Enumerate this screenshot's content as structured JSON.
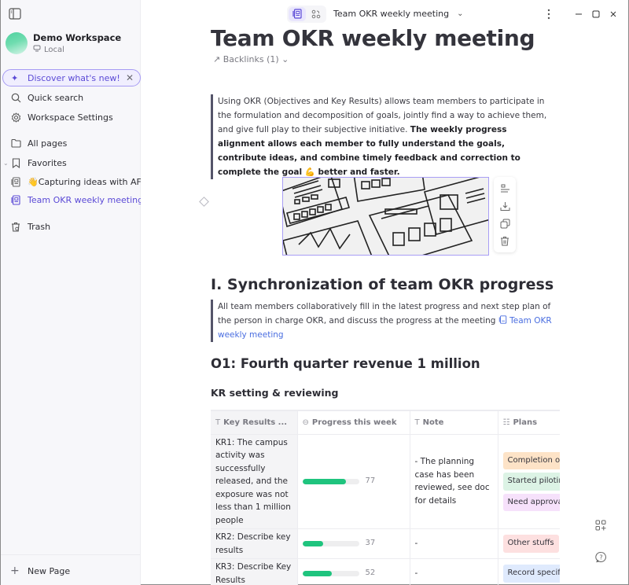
{
  "sidebar": {
    "workspace_name": "Demo Workspace",
    "workspace_type": "Local",
    "discover_label": "Discover what's new!",
    "items": [
      {
        "label": "Quick search",
        "icon": "search-icon"
      },
      {
        "label": "Workspace Settings",
        "icon": "gear-icon"
      },
      {
        "label": "All pages",
        "icon": "folder-icon"
      },
      {
        "label": "Favorites",
        "icon": "bookmark-icon"
      },
      {
        "label": "👋Capturing ideas with AF...",
        "icon": "page-icon"
      },
      {
        "label": "Team OKR weekly meeting",
        "icon": "page-icon",
        "active": true
      },
      {
        "label": "Trash",
        "icon": "trash-icon"
      }
    ],
    "new_page_label": "New Page"
  },
  "topbar": {
    "doc_title": "Team OKR weekly meeting"
  },
  "page": {
    "title": "Team OKR weekly meeting",
    "backlinks": "↗ Backlinks (1) ⌄",
    "intro_plain": "Using OKR (Objectives and Key Results) allows team members to participate in the formulation and decomposition of goals, jointly find a way to achieve them, and give full play to their subjective initiative. ",
    "intro_bold": "The weekly progress alignment allows each member to fully understand the goals, contribute ideas, and combine timely feedback and correction to complete the goal 💪 better and faster.",
    "section1_heading": "I. Synchronization of team OKR progress",
    "section1_text": "All team members collaboratively fill in the latest progress and next step plan of the person in charge OKR, and discuss the progress at the meeting ",
    "section1_link": "Team OKR weekly meeting",
    "objective_heading": "O1: Fourth quarter revenue 1 million",
    "kr_heading": "KR setting & reviewing"
  },
  "table": {
    "columns": [
      "Key Results ...",
      "Progress this week",
      "Note",
      "Plans"
    ],
    "rows": [
      {
        "kr": "KR1: The campus activity was successfully released, and the exposure was not less than 1 million people",
        "progress": 77,
        "note": "- The planning case has been reviewed, see doc for details",
        "plans": [
          {
            "label": "Completion of b",
            "color": "#fde3c7"
          },
          {
            "label": "Started piloting",
            "color": "#dcf3e5"
          },
          {
            "label": "Need approval c",
            "color": "#f6e1fb"
          }
        ]
      },
      {
        "kr": "KR2: Describe key results",
        "progress": 37,
        "note": "-",
        "plans": [
          {
            "label": "Other stuffs",
            "color": "#fde0e0"
          }
        ]
      },
      {
        "kr": "KR3: Describe Key Results",
        "progress": 52,
        "note": "-",
        "plans": [
          {
            "label": "Record specific",
            "color": "#dfeafd"
          }
        ]
      }
    ]
  },
  "colors": {
    "accent": "#5b4ad6",
    "progress": "#1fc47e",
    "link": "#4a6ee0"
  }
}
